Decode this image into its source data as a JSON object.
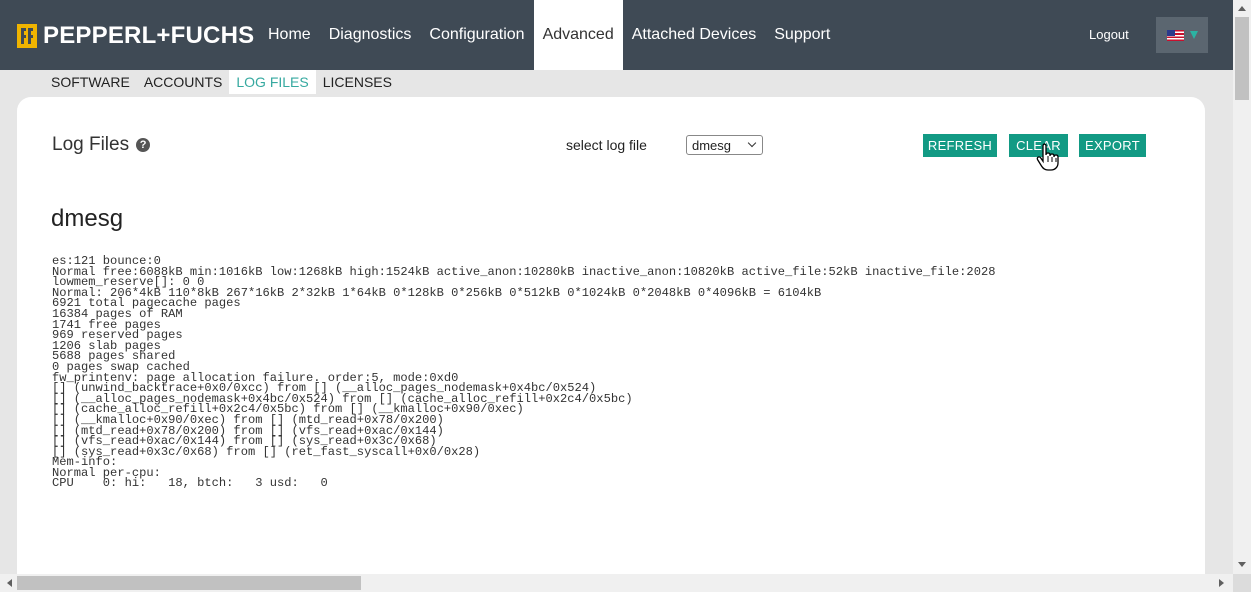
{
  "brand": {
    "name": "PEPPERL+FUCHS"
  },
  "nav": {
    "items": [
      {
        "label": "Home"
      },
      {
        "label": "Diagnostics"
      },
      {
        "label": "Configuration"
      },
      {
        "label": "Advanced",
        "active": true
      },
      {
        "label": "Attached Devices"
      },
      {
        "label": "Support"
      }
    ],
    "logout": "Logout",
    "language_icon": "us-flag-icon"
  },
  "subnav": {
    "items": [
      {
        "label": "SOFTWARE"
      },
      {
        "label": "ACCOUNTS"
      },
      {
        "label": "LOG FILES",
        "active": true
      },
      {
        "label": "LICENSES"
      }
    ]
  },
  "page": {
    "title": "Log Files",
    "select_label": "select log file",
    "select_value": "dmesg",
    "buttons": {
      "refresh": "REFRESH",
      "clear": "CLEAR",
      "export": "EXPORT"
    },
    "log_heading": "dmesg",
    "log_lines": [
      "es:121 bounce:0",
      "Normal free:6088kB min:1016kB low:1268kB high:1524kB active_anon:10280kB inactive_anon:10820kB active_file:52kB inactive_file:2028",
      "lowmem_reserve[]: 0 0",
      "Normal: 206*4kB 110*8kB 267*16kB 2*32kB 1*64kB 0*128kB 0*256kB 0*512kB 0*1024kB 0*2048kB 0*4096kB = 6104kB",
      "6921 total pagecache pages",
      "16384 pages of RAM",
      "1741 free pages",
      "969 reserved pages",
      "1206 slab pages",
      "5688 pages shared",
      "0 pages swap cached",
      "fw_printenv: page allocation failure. order:5, mode:0xd0",
      "[] (unwind_backtrace+0x0/0xcc) from [] (__alloc_pages_nodemask+0x4bc/0x524)",
      "[] (__alloc_pages_nodemask+0x4bc/0x524) from [] (cache_alloc_refill+0x2c4/0x5bc)",
      "[] (cache_alloc_refill+0x2c4/0x5bc) from [] (__kmalloc+0x90/0xec)",
      "[] (__kmalloc+0x90/0xec) from [] (mtd_read+0x78/0x200)",
      "[] (mtd_read+0x78/0x200) from [] (vfs_read+0xac/0x144)",
      "[] (vfs_read+0xac/0x144) from [] (sys_read+0x3c/0x68)",
      "[] (sys_read+0x3c/0x68) from [] (ret_fast_syscall+0x0/0x28)",
      "Mem-info:",
      "Normal per-cpu:",
      "CPU    0: hi:   18, btch:   3 usd:   0"
    ]
  },
  "colors": {
    "navbar": "#3f4a55",
    "accent": "#129a84",
    "active_sub": "#36a9a0"
  }
}
